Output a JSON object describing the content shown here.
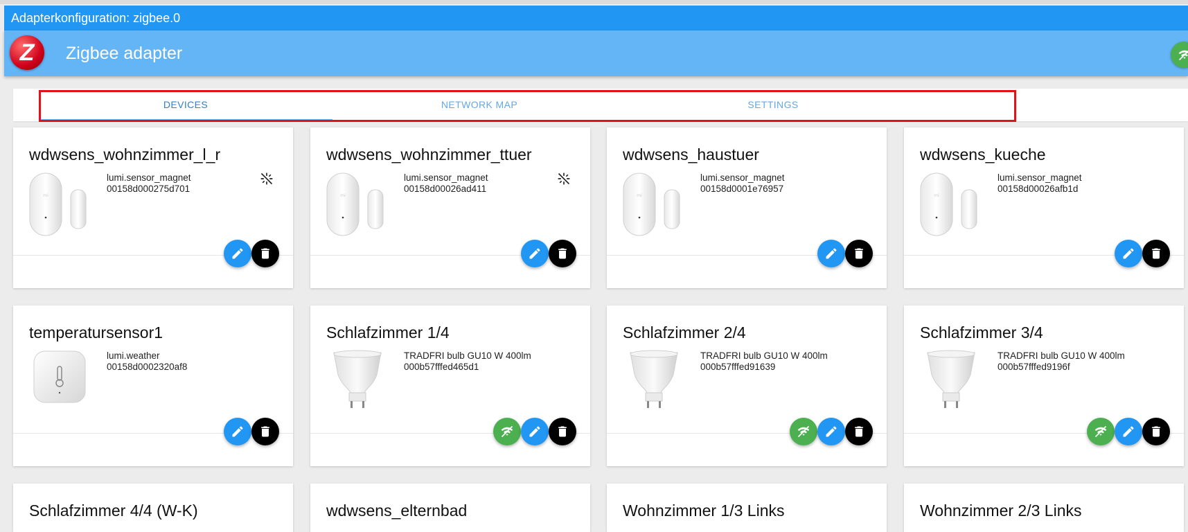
{
  "window": {
    "title": "Adapterkonfiguration: zigbee.0"
  },
  "header": {
    "title": "Zigbee adapter",
    "logo_letter": "Z",
    "status_icon": "wifi-connected-icon",
    "accent": "#64b5f6"
  },
  "tabs": [
    {
      "label": "DEVICES",
      "active": true
    },
    {
      "label": "NETWORK MAP",
      "active": false
    },
    {
      "label": "SETTINGS",
      "active": false
    }
  ],
  "colors": {
    "edit": "#2196f3",
    "delete": "#000000",
    "link": "#4caf50",
    "highlight": "#e3101a"
  },
  "devices": [
    {
      "name": "wdwsens_wohnzimmer_l_r",
      "model": "lumi.sensor_magnet",
      "id": "00158d000275d701",
      "image": "door-sensor",
      "no_link": true,
      "link_quality": false
    },
    {
      "name": "wdwsens_wohnzimmer_ttuer",
      "model": "lumi.sensor_magnet",
      "id": "00158d00026ad411",
      "image": "door-sensor",
      "no_link": true,
      "link_quality": false
    },
    {
      "name": "wdwsens_haustuer",
      "model": "lumi.sensor_magnet",
      "id": "00158d0001e76957",
      "image": "door-sensor",
      "no_link": false,
      "link_quality": false
    },
    {
      "name": "wdwsens_kueche",
      "model": "lumi.sensor_magnet",
      "id": "00158d00026afb1d",
      "image": "door-sensor",
      "no_link": false,
      "link_quality": false
    },
    {
      "name": "temperatursensor1",
      "model": "lumi.weather",
      "id": "00158d0002320af8",
      "image": "weather-sensor",
      "no_link": false,
      "link_quality": false
    },
    {
      "name": "Schlafzimmer 1/4",
      "model": "TRADFRI bulb GU10 W 400lm",
      "id": "000b57fffed465d1",
      "image": "gu10-bulb",
      "no_link": false,
      "link_quality": true
    },
    {
      "name": "Schlafzimmer 2/4",
      "model": "TRADFRI bulb GU10 W 400lm",
      "id": "000b57fffed91639",
      "image": "gu10-bulb",
      "no_link": false,
      "link_quality": true
    },
    {
      "name": "Schlafzimmer 3/4",
      "model": "TRADFRI bulb GU10 W 400lm",
      "id": "000b57fffed9196f",
      "image": "gu10-bulb",
      "no_link": false,
      "link_quality": true
    },
    {
      "name": "Schlafzimmer 4/4 (W-K)",
      "model": "",
      "id": "",
      "image": "",
      "no_link": false,
      "link_quality": false
    },
    {
      "name": "wdwsens_elternbad",
      "model": "",
      "id": "",
      "image": "",
      "no_link": false,
      "link_quality": false
    },
    {
      "name": "Wohnzimmer 1/3 Links",
      "model": "",
      "id": "",
      "image": "",
      "no_link": false,
      "link_quality": false
    },
    {
      "name": "Wohnzimmer 2/3 Links",
      "model": "",
      "id": "",
      "image": "",
      "no_link": false,
      "link_quality": false
    }
  ]
}
